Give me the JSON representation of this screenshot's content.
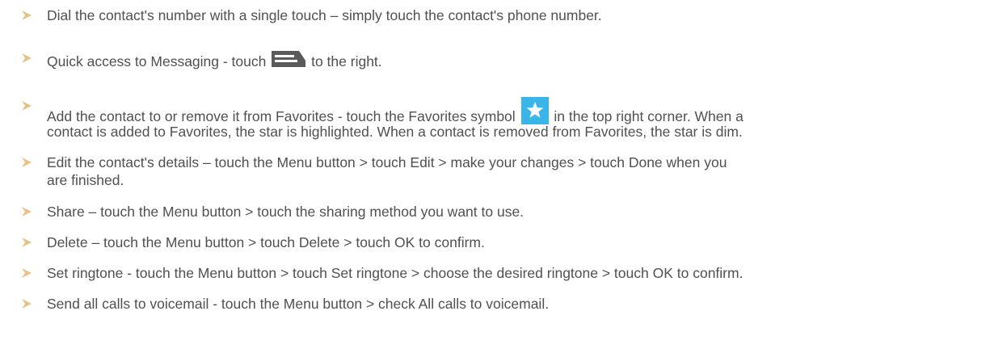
{
  "colors": {
    "text": "#505050",
    "bullet": "#e9c187",
    "message_icon": "#5a5a5a",
    "favorite_icon_bg": "#39b5e8",
    "favorite_star": "#ffffff"
  },
  "bullets": [
    {
      "text": "Dial the contact's number with a single touch – simply touch the contact's phone number."
    },
    {
      "before": "Quick access to Messaging  - touch ",
      "icon": "message-icon",
      "after": " to the right."
    },
    {
      "before": "Add the contact to or remove it from Favorites - touch the Favorites symbol ",
      "icon": "star-icon",
      "after": " in the top right corner. When a",
      "line2": "contact is added to Favorites, the star is highlighted. When a contact is removed from Favorites, the star is dim."
    },
    {
      "line1": "Edit the contact's details – touch the Menu button > touch Edit > make your changes > touch Done when you",
      "line2": "are finished."
    },
    {
      "text": "Share – touch the Menu button > touch the sharing method you want to use."
    },
    {
      "text": "Delete – touch the Menu button > touch Delete > touch OK to confirm."
    },
    {
      "text": "Set ringtone - touch the Menu button > touch Set ringtone > choose the desired ringtone > touch OK to confirm."
    },
    {
      "text": "Send all calls to voicemail - touch the Menu button > check All calls to voicemail."
    }
  ]
}
